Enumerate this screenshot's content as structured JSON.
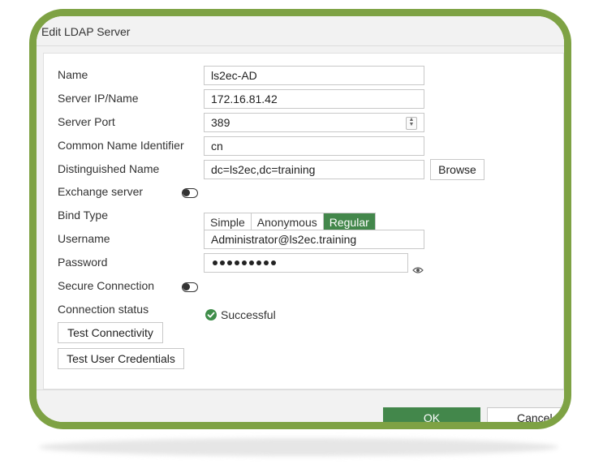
{
  "dialog": {
    "title": "Edit LDAP Server"
  },
  "fields": {
    "name": {
      "label": "Name",
      "value": "ls2ec-AD"
    },
    "server_ip": {
      "label": "Server IP/Name",
      "value": "172.16.81.42"
    },
    "server_port": {
      "label": "Server Port",
      "value": "389"
    },
    "cn_identifier": {
      "label": "Common Name Identifier",
      "value": "cn"
    },
    "distinguished_name": {
      "label": "Distinguished Name",
      "value": "dc=ls2ec,dc=training",
      "browse_label": "Browse"
    },
    "exchange_server": {
      "label": "Exchange server",
      "enabled": false
    },
    "bind_type": {
      "label": "Bind Type",
      "options": [
        "Simple",
        "Anonymous",
        "Regular"
      ],
      "selected": "Regular"
    },
    "username": {
      "label": "Username",
      "value": "Administrator@ls2ec.training"
    },
    "password": {
      "label": "Password",
      "masked_length": 9
    },
    "secure_connection": {
      "label": "Secure Connection",
      "enabled": false
    },
    "connection_status": {
      "label": "Connection status",
      "value": "Successful"
    }
  },
  "buttons": {
    "test_connectivity": "Test Connectivity",
    "test_user_credentials": "Test User Credentials",
    "ok": "OK",
    "cancel": "Cancel"
  },
  "icons": {
    "password_reveal": "eye-icon",
    "status": "check-circle-icon",
    "port_spinner": "spinner-icon"
  },
  "colors": {
    "frame_border": "#7ea244",
    "accent_green": "#43874b",
    "status_green": "#3f8d4a"
  }
}
